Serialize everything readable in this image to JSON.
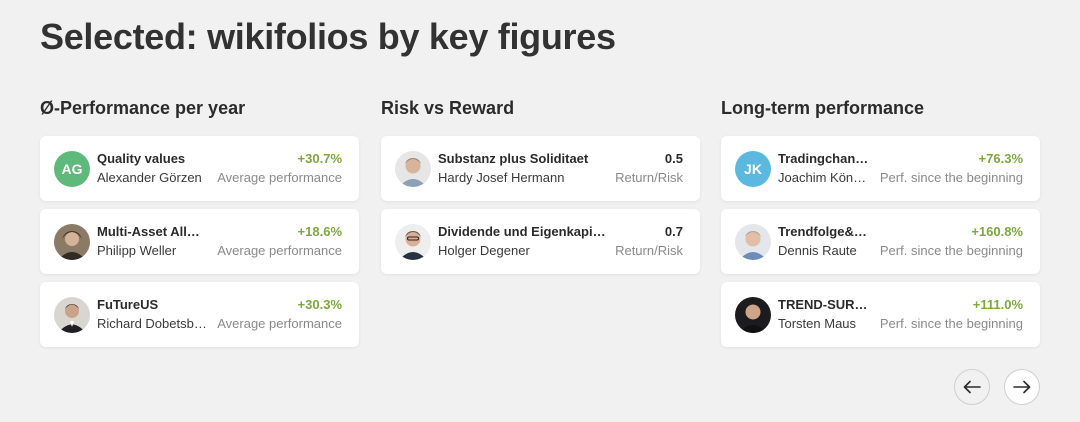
{
  "page_title": "Selected: wikifolios by key figures",
  "columns": [
    {
      "title": "Ø-Performance per year",
      "cards": [
        {
          "name": "Quality values",
          "trader": "Alexander Görzen",
          "value": "+30.7%",
          "label": "Average performance",
          "avatar": {
            "type": "initials",
            "text": "AG",
            "color": "#5fb97a"
          }
        },
        {
          "name": "Multi-Asset All…",
          "trader": "Philipp Weller",
          "value": "+18.6%",
          "label": "Average performance",
          "avatar": {
            "type": "photo",
            "icon": "person-photo-icon"
          }
        },
        {
          "name": "FuTureUS",
          "trader": "Richard Dobetsb…",
          "value": "+30.3%",
          "label": "Average performance",
          "avatar": {
            "type": "photo",
            "icon": "person-photo-icon"
          }
        }
      ]
    },
    {
      "title": "Risk vs Reward",
      "cards": [
        {
          "name": "Substanz plus Soliditaet",
          "trader": "Hardy Josef Hermann",
          "value": "0.5",
          "label": "Return/Risk",
          "avatar": {
            "type": "photo",
            "icon": "person-photo-icon"
          }
        },
        {
          "name": "Dividende und Eigenkapi…",
          "trader": "Holger Degener",
          "value": "0.7",
          "label": "Return/Risk",
          "avatar": {
            "type": "photo",
            "icon": "person-photo-icon"
          }
        }
      ]
    },
    {
      "title": "Long-term performance",
      "cards": [
        {
          "name": "Tradingchan…",
          "trader": "Joachim Kön…",
          "value": "+76.3%",
          "label": "Perf. since the beginning",
          "avatar": {
            "type": "initials",
            "text": "JK",
            "color": "#5bb9df"
          }
        },
        {
          "name": "Trendfolge&…",
          "trader": "Dennis Raute",
          "value": "+160.8%",
          "label": "Perf. since the beginning",
          "avatar": {
            "type": "photo",
            "icon": "person-photo-icon"
          }
        },
        {
          "name": "TREND-SUR…",
          "trader": "Torsten Maus",
          "value": "+111.0%",
          "label": "Perf. since the beginning",
          "avatar": {
            "type": "photo",
            "icon": "person-photo-icon"
          }
        }
      ]
    }
  ],
  "navigation": {
    "prev_icon": "arrow-left-icon",
    "next_icon": "arrow-right-icon"
  },
  "colors": {
    "positive": "#7caa3a",
    "background": "#f1f1f1",
    "card": "#ffffff"
  }
}
